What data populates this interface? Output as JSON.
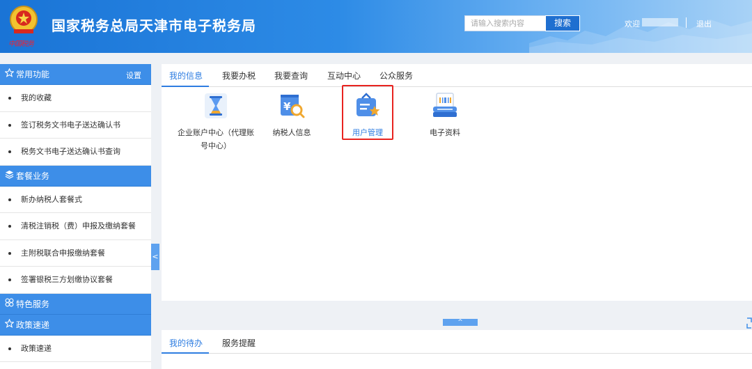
{
  "header": {
    "title": "国家税务总局天津市电子税务局",
    "emblem_caption": "中国税务",
    "search": {
      "placeholder": "请输入搜索内容",
      "button": "搜索"
    },
    "welcome": "欢迎",
    "logout": "退出",
    "accent_color": "#2d8be6"
  },
  "sidebar": {
    "sections": [
      {
        "title": "常用功能",
        "icon": "star-icon",
        "setting": "设置",
        "items": [
          "我的收藏",
          "签订税务文书电子送达确认书",
          "税务文书电子送达确认书查询"
        ]
      },
      {
        "title": "套餐业务",
        "icon": "layers-icon",
        "items": [
          "新办纳税人套餐式",
          "清税注销税（费）申报及缴纳套餐",
          "主附税联合申报缴纳套餐",
          "签署银税三方划缴协议套餐"
        ]
      },
      {
        "title": "特色服务",
        "icon": "clover-icon",
        "items": []
      },
      {
        "title": "政策速递",
        "icon": "star-icon",
        "items": [
          "政策速递"
        ]
      }
    ],
    "collapse_glyph": "<"
  },
  "main": {
    "tabs": [
      "我的信息",
      "我要办税",
      "我要查询",
      "互动中心",
      "公众服务"
    ],
    "active_tab": "我的信息",
    "apps": [
      {
        "label_line1": "企业账户中心（代理账",
        "label_line2": "号中心）",
        "icon": "hourglass-icon"
      },
      {
        "label": "纳税人信息",
        "icon": "taxpayer-search-icon"
      },
      {
        "label": "用户管理",
        "icon": "user-manage-icon",
        "highlighted": true
      },
      {
        "label": "电子资料",
        "icon": "scanner-icon"
      }
    ],
    "expand_glyph": "^"
  },
  "bottom": {
    "tabs": [
      "我的待办",
      "服务提醒"
    ],
    "active_tab": "我的待办"
  }
}
